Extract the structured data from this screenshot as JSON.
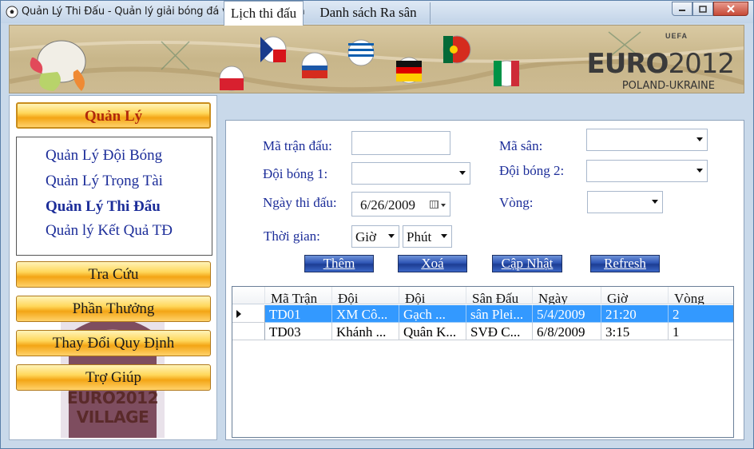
{
  "window": {
    "title": "Quản Lý Thi Đấu - Quản lý giải bóng đá vô địch quốc gia",
    "minimize_icon": "minimize-icon",
    "maximize_icon": "maximize-icon",
    "close_icon": "close-icon"
  },
  "banner": {
    "brand": "EURO",
    "year": "2012",
    "uefa": "UEFA",
    "sub": "POLAND-UKRAINE"
  },
  "sidebar": {
    "group_quanly": "Quản Lý",
    "items": [
      {
        "label": "Quản Lý Đội Bóng"
      },
      {
        "label": "Quản Lý Trọng Tài"
      },
      {
        "label": "Quản Lý Thi Đấu"
      },
      {
        "label": "Quản lý Kết Quả TĐ"
      }
    ],
    "btn_tracuu": "Tra Cứu",
    "btn_phanthuong": "Phần Thưởng",
    "btn_thaydoi": "Thay Đổi Quy Định",
    "btn_trogiup": "Trợ Giúp",
    "village_line1": "EURO2012",
    "village_line2": "VILLAGE"
  },
  "tabs": [
    {
      "label": "Lịch thi đấu"
    },
    {
      "label": "Danh sách Ra sân"
    }
  ],
  "form": {
    "ma_tran_dau_label": "Mã trận đấu:",
    "ma_tran_dau_value": "",
    "ma_san_label": "Mã sân:",
    "ma_san_value": "",
    "doi_bong_1_label": "Đội bóng 1:",
    "doi_bong_1_value": "",
    "doi_bong_2_label": "Đội bóng 2:",
    "doi_bong_2_value": "",
    "ngay_label": "Ngày thi đấu:",
    "ngay_value": "6/26/2009",
    "vong_label": "Vòng:",
    "vong_value": "",
    "thoi_gian_label": "Thời gian:",
    "gio_value": "Giờ",
    "phut_value": "Phút"
  },
  "buttons": {
    "them": "Thêm",
    "xoa": "Xoá",
    "cap_nhat": "Cập Nhật",
    "refresh": "Refresh"
  },
  "grid": {
    "columns": [
      "Mã Trận",
      "Đội",
      "Đội",
      "Sân Đấu",
      "Ngày",
      "Giờ",
      "Vòng"
    ],
    "rows": [
      [
        "TD01",
        "XM Cô...",
        "Gạch ...",
        "sân Plei...",
        "5/4/2009",
        "21:20",
        "2"
      ],
      [
        "TD03",
        "Khánh ...",
        "Quân K...",
        "SVĐ C...",
        "6/8/2009",
        "3:15",
        "1"
      ]
    ],
    "selected_row": 0
  },
  "colors": {
    "accent_gold": "#f3a515",
    "menu_blue": "#1c2d99",
    "selection": "#3399ff"
  }
}
